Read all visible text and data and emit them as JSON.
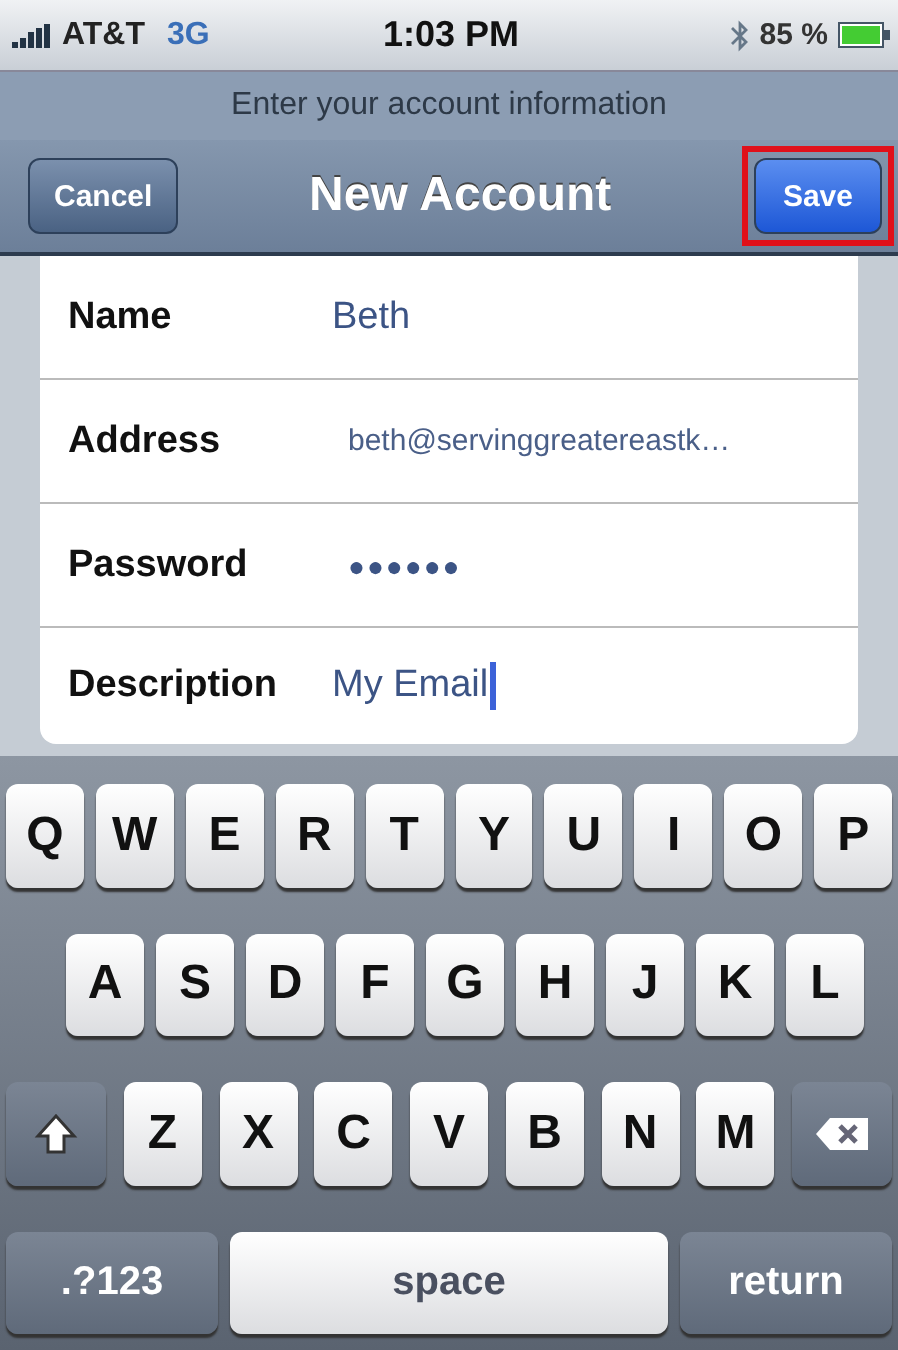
{
  "status_bar": {
    "carrier": "AT&T",
    "network": "3G",
    "time": "1:03 PM",
    "battery": "85 %"
  },
  "prompt": "Enter your account information",
  "nav": {
    "cancel": "Cancel",
    "title": "New Account",
    "save": {
      "label": "Save",
      "highlighted": true
    }
  },
  "fields": [
    {
      "label": "Name",
      "value": "Beth",
      "kind": "text",
      "focused": false
    },
    {
      "label": "Address",
      "value": "beth@servinggreatereastk…",
      "kind": "small",
      "focused": false
    },
    {
      "label": "Password",
      "value": "●●●●●●",
      "kind": "password",
      "focused": false
    },
    {
      "label": "Description",
      "value": "My Email",
      "kind": "text",
      "focused": true
    }
  ],
  "keyboard": {
    "rows": [
      [
        "Q",
        "W",
        "E",
        "R",
        "T",
        "Y",
        "U",
        "I",
        "O",
        "P"
      ],
      [
        "A",
        "S",
        "D",
        "F",
        "G",
        "H",
        "J",
        "K",
        "L"
      ],
      [
        "Z",
        "X",
        "C",
        "V",
        "B",
        "N",
        "M"
      ]
    ],
    "numbers_key": ".?123",
    "space_key": "space",
    "return_key": "return"
  }
}
